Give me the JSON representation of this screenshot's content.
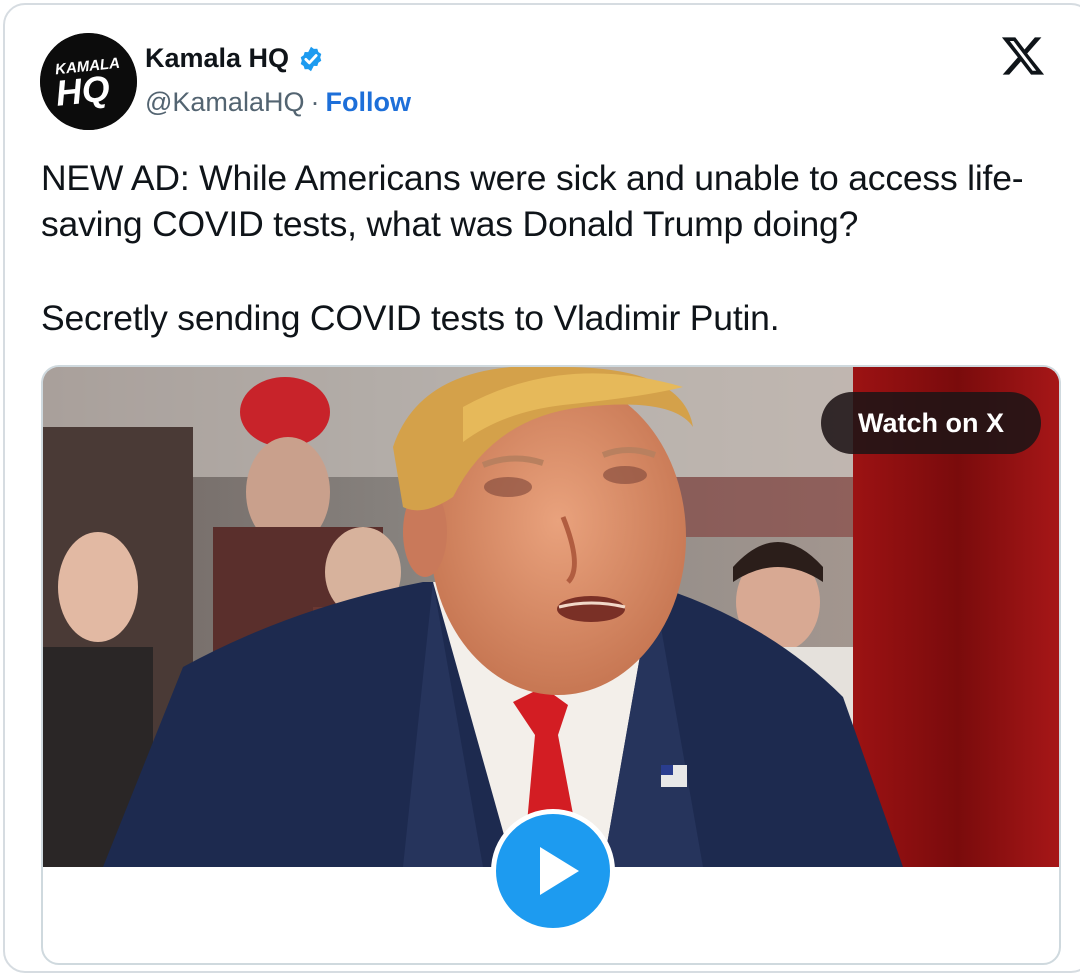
{
  "author": {
    "display_name": "Kamala HQ",
    "handle": "@KamalaHQ",
    "separator": "·",
    "follow_label": "Follow",
    "avatar": {
      "text_top": "KAMALA",
      "text_bottom": "HQ"
    },
    "verified_icon": "verified-badge-icon"
  },
  "platform": {
    "logo_icon": "x-logo-icon"
  },
  "tweet": {
    "paragraphs": [
      "NEW AD: While Americans were sick and unable to access life-saving COVID tests, what was Donald Trump doing?",
      "Secretly sending COVID tests to Vladimir Putin."
    ]
  },
  "media": {
    "watch_label": "Watch on X",
    "play_icon": "play-icon"
  },
  "colors": {
    "accent": "#1d9bf0",
    "follow": "#1d6fd9",
    "text": "#0f1419",
    "secondary": "#536471"
  }
}
